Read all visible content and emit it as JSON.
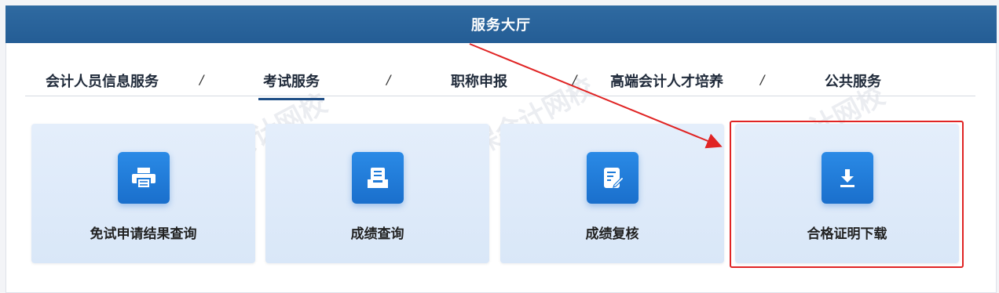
{
  "header": {
    "title": "服务大厅"
  },
  "tabs": [
    {
      "label": "会计人员信息服务",
      "active": false
    },
    {
      "label": "考试服务",
      "active": true
    },
    {
      "label": "职称申报",
      "active": false
    },
    {
      "label": "高端会计人才培养",
      "active": false
    },
    {
      "label": "公共服务",
      "active": false
    }
  ],
  "separator": "/",
  "cards": [
    {
      "label": "免试申请结果查询",
      "icon": "printer-icon"
    },
    {
      "label": "成绩查询",
      "icon": "document-tray-icon"
    },
    {
      "label": "成绩复核",
      "icon": "edit-document-icon"
    },
    {
      "label": "合格证明下载",
      "icon": "download-icon",
      "highlighted": true
    }
  ],
  "colors": {
    "header_bg": "#2f6aa1",
    "card_bg": "#dde9f9",
    "icon_bg": "#1f7bd9",
    "annotation": "#e02424"
  }
}
